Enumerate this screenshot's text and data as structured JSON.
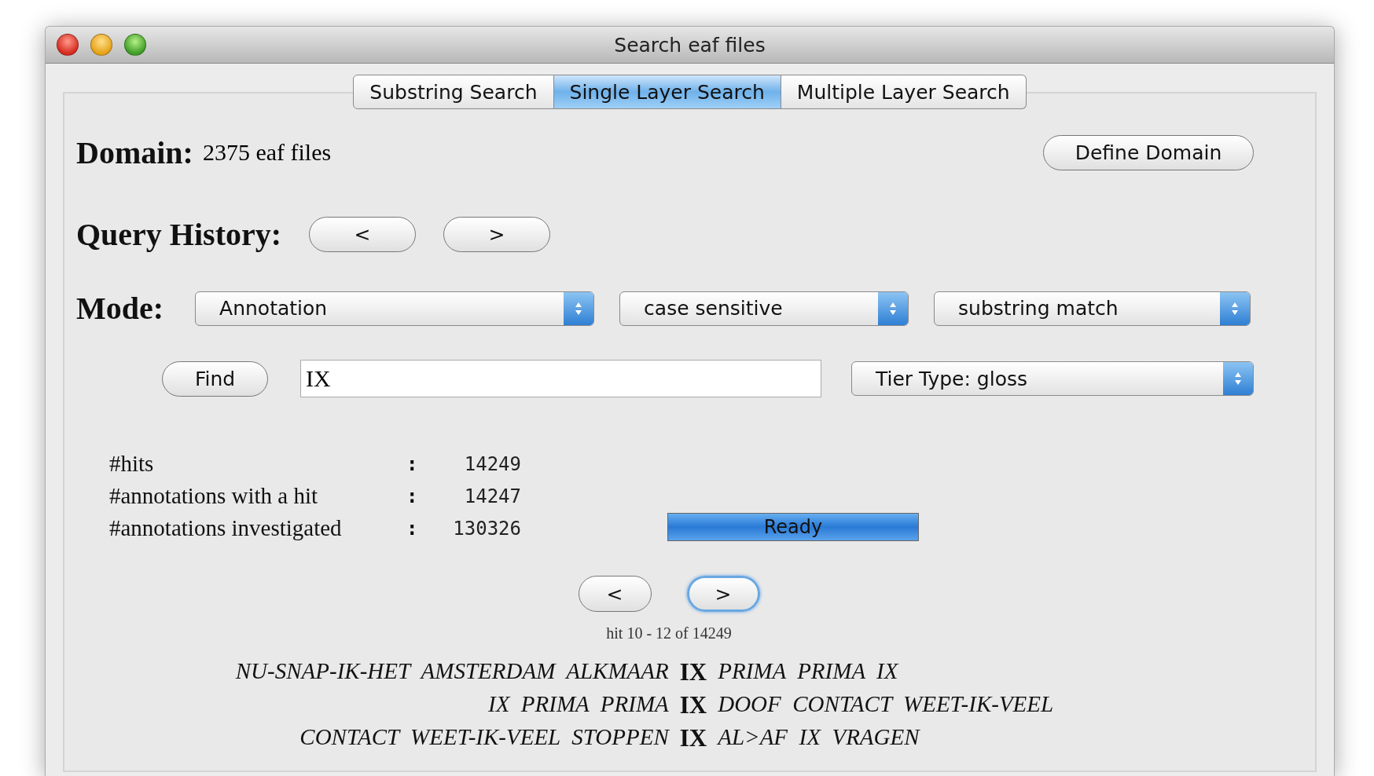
{
  "window": {
    "title": "Search eaf files"
  },
  "tabs": [
    {
      "label": "Substring Search",
      "selected": false
    },
    {
      "label": "Single Layer Search",
      "selected": true
    },
    {
      "label": "Multiple Layer Search",
      "selected": false
    }
  ],
  "domain": {
    "label": "Domain:",
    "value": "2375 eaf files",
    "button": "Define Domain"
  },
  "query_history": {
    "label": "Query History:",
    "buttons": [
      "<",
      ">"
    ]
  },
  "mode": {
    "label": "Mode:",
    "selects": [
      "Annotation",
      "case sensitive",
      "substring match"
    ]
  },
  "find": {
    "button": "Find",
    "value": "IX",
    "tier_select": "Tier Type: gloss"
  },
  "stats": [
    {
      "label": "#hits",
      "separator": ":",
      "value": "14249"
    },
    {
      "label": "#annotations with a hit",
      "separator": ":",
      "value": "14247"
    },
    {
      "label": "#annotations investigated",
      "separator": ":",
      "value": "130326"
    }
  ],
  "progress": {
    "level": 1,
    "text": "Ready"
  },
  "hit_nav": {
    "buttons": [
      {
        "label": "<",
        "focused": false
      },
      {
        "label": ">",
        "focused": true
      }
    ],
    "status": "hit 10 - 12 of 14249"
  },
  "results": [
    {
      "left": "NU-SNAP-IK-HET  AMSTERDAM  ALKMAAR",
      "keyword": "IX",
      "right": "PRIMA  PRIMA  IX"
    },
    {
      "left": "IX  PRIMA  PRIMA",
      "keyword": "IX",
      "right": "DOOF  CONTACT  WEET-IK-VEEL"
    },
    {
      "left": "CONTACT  WEET-IK-VEEL  STOPPEN",
      "keyword": "IX",
      "right": "AL>AF  IX  VRAGEN"
    }
  ]
}
